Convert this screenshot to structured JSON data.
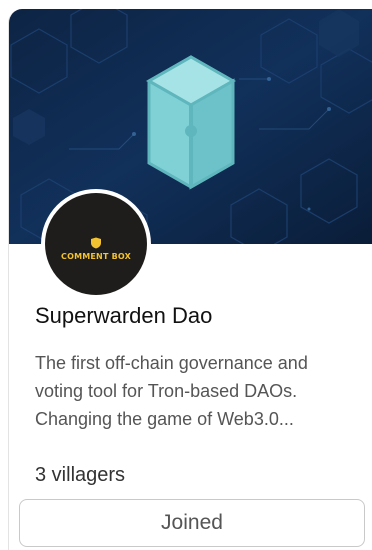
{
  "community": {
    "avatar_text": "COMMENT BOX",
    "name": "Superwarden Dao",
    "description_line1": "The first off-chain governance and",
    "description_line2": "voting tool for Tron-based DAOs.",
    "description_line3": "Changing the game of Web3.0...",
    "members": "3 villagers",
    "join_label": "Joined"
  },
  "colors": {
    "banner_bg": "#0e2747",
    "cube": "#7fd1d6",
    "avatar_bg": "#1f1d1b",
    "avatar_text": "#f2c230"
  },
  "icons": {
    "banner": "cube-icon",
    "avatar": "shield-icon"
  }
}
